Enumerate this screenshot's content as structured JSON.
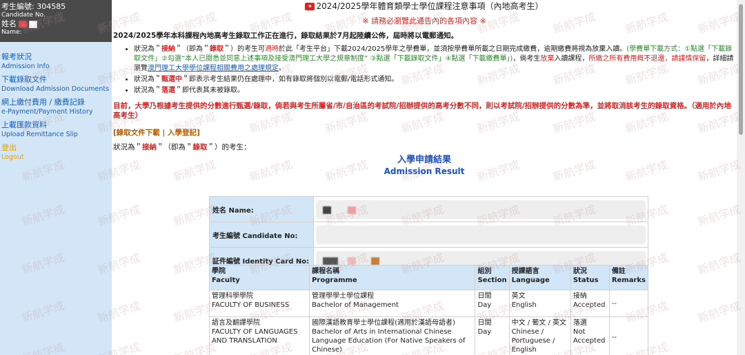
{
  "sidebar": {
    "candidate_label": "考生編號",
    "candidate_no": "304585",
    "candidate_label_en": "Candidate No.",
    "name_label": "姓名",
    "name_label_en": "Name:",
    "nav": [
      {
        "zh": "報考狀況",
        "en": "Admission Info"
      },
      {
        "zh": "下載錄取文件",
        "en": "Download Admission Documents"
      },
      {
        "zh": "網上繳付費用 / 繳費記錄",
        "en": "e-Payment/Payment History"
      },
      {
        "zh": "上載匯款資料",
        "en": "Upload Remittance Slip"
      },
      {
        "zh": "登出",
        "en": "Logout"
      }
    ]
  },
  "header": {
    "title": "2024/2025學年體育類學士學位課程注意事項（內地高考生）",
    "warning": "※ 請務必瀏覽此通告內的各項內容 ※"
  },
  "content": {
    "status_line": "2024/2025學年本科課程內地高考生錄取工作正在進行，錄取結果於7月起陸續公佈，屆時將以電郵通知。",
    "note1": {
      "p1": "狀況為＂",
      "accepted": "接納",
      "p2": "＂（即為＂",
      "admitted": "錄取",
      "p3": "＂）的考生可",
      "timely": "適時",
      "p4": "於此「考生平台」下載2024/2025學年之學費單，並須按學費單所載之日期完成繳費，逾期繳費將視為放棄入讀。",
      "methods": "(學費單下載方式：①點選「下載錄取文件」②勾選“本人已閱悉並同意上述事項及接受澳門理工大學之規章制度” ③點選「下載錄取文件」④點選「下載繳費單」)",
      "p5": "，倘考生",
      "give_up": "放棄",
      "p6": "入讀課程，",
      "no_refund": "所繳之所有費用概不退還，請謹慎保留",
      "p7": "，詳細請瀏覽",
      "link": "澳門理工大學學位課程相關費用之處理規定",
      "p8": "。"
    },
    "note2": {
      "p1": "狀況為＂",
      "status": "甄選中",
      "p2": "＂即表示考生結果仍在處理中，如有錄取將個別以電郵/電話形式通知。"
    },
    "note3": {
      "p1": "狀況為＂",
      "status": "落選",
      "p2": "＂即代表其未被錄取。"
    },
    "alert": "目前，大學乃根據考生提供的分數進行甄選/錄取，倘若與考生所屬省/市/自治區的考試院/招辦提供的高考分數不同，則以考試院/招辦提供的分數為準，並將取消該考生的錄取資格。（適用於內地高考生）",
    "sub_link1": "[錄取文件下載",
    "sub_link_sep": " | ",
    "sub_link2": "入學登記]",
    "status_prefix": {
      "p1": "狀況為＂",
      "accepted": "接納",
      "p2": "＂（即為＂",
      "admitted": "錄取",
      "p3": "＂）的考生："
    }
  },
  "result": {
    "title_zh": "入學申請結果",
    "title_en": "Admission Result",
    "info_labels": [
      "姓名 Name:",
      "考生編號 Candidate No:",
      "証件編號 Identity Card No:"
    ],
    "headers": [
      {
        "zh": "學院",
        "en": "Faculty"
      },
      {
        "zh": "課程名稱",
        "en": "Programme"
      },
      {
        "zh": "組別",
        "en": "Section"
      },
      {
        "zh": "授課語言",
        "en": "Language"
      },
      {
        "zh": "狀況",
        "en": "Status"
      },
      {
        "zh": "備註",
        "en": "Remarks"
      }
    ],
    "rows": [
      {
        "faculty_zh": "管理科學學院",
        "faculty_en": "FACULTY OF BUSINESS",
        "programme_zh": "管理學學士學位課程",
        "programme_en": "Bachelor of Management",
        "section_zh": "日間",
        "section_en": "Day",
        "language_zh": "英文",
        "language_en": "English",
        "status_zh": "接納",
        "status_en": "Accepted",
        "remarks": "--"
      },
      {
        "faculty_zh": "語言及翻譯學院",
        "faculty_en": "FACULTY OF LANGUAGES AND TRANSLATION",
        "programme_zh": "國際漢語教育學士學位課程(適用於漢語母語者)",
        "programme_en": "Bachelor of Arts in International Chinese Language Education (For Native Speakers of Chinese)",
        "section_zh": "日間",
        "section_en": "Day",
        "language_zh": "中文 / 葡文 / 英文",
        "language_en": "Chinese / Portuguese / English",
        "status_zh": "落選",
        "status_en": "Not Accepted",
        "remarks": "--"
      }
    ]
  },
  "watermark_text": "新航学成",
  "colors": {
    "accent_red": "#dd2222",
    "link_blue": "#1a5fb4",
    "sidebar_bg": "#d3e6f7",
    "header_dark": "#4a4a4a"
  }
}
